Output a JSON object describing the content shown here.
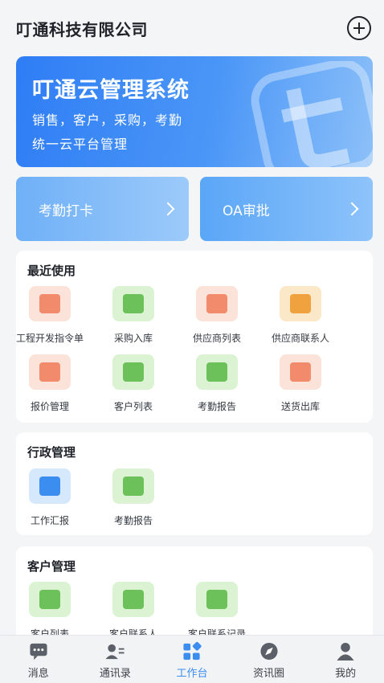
{
  "header": {
    "title": "叮通科技有限公司"
  },
  "banner": {
    "title": "叮通云管理系统",
    "line1": "销售，客户，采购，考勤",
    "line2": "统一云平台管理"
  },
  "quick": {
    "attendance": "考勤打卡",
    "oa": "OA审批"
  },
  "recent": {
    "title": "最近使用",
    "items": [
      {
        "label": "工程开发指令单",
        "icon": "stack-icon",
        "color": "orange"
      },
      {
        "label": "采购入库",
        "icon": "warehouse-truck-icon",
        "color": "green"
      },
      {
        "label": "供应商列表",
        "icon": "supplier-store-icon",
        "color": "orange"
      },
      {
        "label": "供应商联系人",
        "icon": "contact-book-icon",
        "color": "yellow"
      },
      {
        "label": "报价管理",
        "icon": "yuan-quote-icon",
        "color": "orange"
      },
      {
        "label": "客户列表",
        "icon": "customer-check-icon",
        "color": "green"
      },
      {
        "label": "考勤报告",
        "icon": "calendar-chart-icon",
        "color": "green"
      },
      {
        "label": "送货出库",
        "icon": "delivery-truck-icon",
        "color": "orange"
      }
    ]
  },
  "admin": {
    "title": "行政管理",
    "items": [
      {
        "label": "工作汇报",
        "icon": "report-edit-icon",
        "color": "blue"
      },
      {
        "label": "考勤报告",
        "icon": "calendar-chart-icon",
        "color": "green"
      }
    ]
  },
  "customer": {
    "title": "客户管理",
    "items": [
      {
        "label": "客户列表",
        "icon": "customer-check-icon",
        "color": "green"
      },
      {
        "label": "客户联系人",
        "icon": "contact-book-icon",
        "color": "green"
      },
      {
        "label": "客户联系记录",
        "icon": "phone-record-icon",
        "color": "green"
      }
    ]
  },
  "tabs": [
    {
      "label": "消息",
      "icon": "message-icon",
      "active": false
    },
    {
      "label": "通讯录",
      "icon": "contacts-icon",
      "active": false
    },
    {
      "label": "工作台",
      "icon": "workbench-icon",
      "active": true
    },
    {
      "label": "资讯圈",
      "icon": "compass-icon",
      "active": false
    },
    {
      "label": "我的",
      "icon": "profile-icon",
      "active": false
    }
  ],
  "colors": {
    "primary": "#3b8ef0",
    "orange": "#f28a6c",
    "green": "#6cc15a",
    "yellow": "#f0a23e"
  }
}
